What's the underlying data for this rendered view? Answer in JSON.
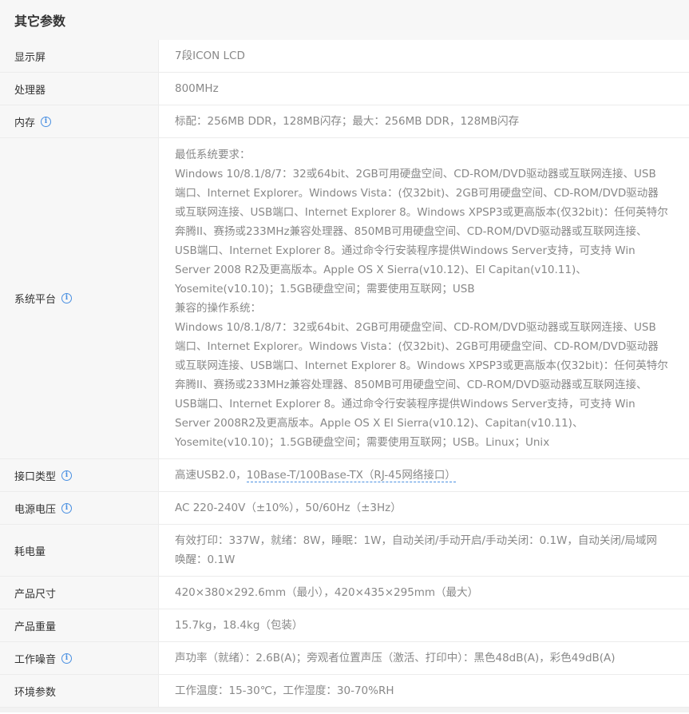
{
  "section": {
    "title": "其它参数"
  },
  "rows": {
    "display": {
      "label": "显示屏",
      "value": "7段ICON LCD"
    },
    "processor": {
      "label": "处理器",
      "value": "800MHz"
    },
    "memory": {
      "label": "内存",
      "value": "标配：256MB DDR，128MB闪存；最大：256MB DDR，128MB闪存"
    },
    "platform": {
      "label": "系统平台",
      "lines": [
        "最低系统要求：",
        "Windows 10/8.1/8/7：32或64bit、2GB可用硬盘空间、CD-ROM/DVD驱动器或互联网连接、USB",
        "端口、Internet Explorer。Windows Vista：(仅32bit)、2GB可用硬盘空间、CD-ROM/DVD驱动器",
        "或互联网连接、USB端口、Internet Explorer 8。Windows XPSP3或更高版本(仅32bit)：任何英特尔",
        "奔腾II、赛扬或233MHz兼容处理器、850MB可用硬盘空间、CD-ROM/DVD驱动器或互联网连接、",
        "USB端口、Internet Explorer 8。通过命令行安装程序提供Windows Server支持，可支持 Win",
        "Server 2008 R2及更高版本。Apple OS X Sierra(v10.12)、El Capitan(v10.11)、",
        "Yosemite(v10.10)；1.5GB硬盘空间；需要使用互联网；USB",
        "兼容的操作系统：",
        "Windows 10/8.1/8/7：32或64bit、2GB可用硬盘空间、CD-ROM/DVD驱动器或互联网连接、USB",
        "端口、Internet Explorer。Windows Vista：(仅32bit)、2GB可用硬盘空间、CD-ROM/DVD驱动器",
        "或互联网连接、USB端口、Internet Explorer 8。Windows XPSP3或更高版本(仅32bit)：任何英特尔",
        "奔腾II、赛扬或233MHz兼容处理器、850MB可用硬盘空间、CD-ROM/DVD驱动器或互联网连接、",
        "USB端口、Internet Explorer 8。通过命令行安装程序提供Windows Server支持，可支持 Win",
        "Server 2008R2及更高版本。Apple OS X El Sierra(v10.12)、Capitan(v10.11)、",
        "Yosemite(v10.10)；1.5GB硬盘空间；需要使用互联网；USB。Linux；Unix"
      ]
    },
    "interface": {
      "label": "接口类型",
      "value_prefix": "高速USB2.0，",
      "value_link": "10Base-T/100Base-TX（RJ-45网络接口）"
    },
    "voltage": {
      "label": "电源电压",
      "value": "AC 220-240V（±10%），50/60Hz（±3Hz）"
    },
    "power": {
      "label": "耗电量",
      "line1": "有效打印：337W，就绪：8W，睡眠：1W，自动关闭/手动开启/手动关闭：0.1W，自动关闭/局域网",
      "line2": "唤醒：0.1W"
    },
    "size": {
      "label": "产品尺寸",
      "value": "420×380×292.6mm（最小），420×435×295mm（最大）"
    },
    "weight": {
      "label": "产品重量",
      "value": "15.7kg，18.4kg（包装）"
    },
    "noise": {
      "label": "工作噪音",
      "value": "声功率（就绪）：2.6B(A)；旁观者位置声压（激活、打印中）：黑色48dB(A)，彩色49dB(A)"
    },
    "environment": {
      "label": "环境参数",
      "value": "工作温度：15-30℃，工作湿度：30-70%RH"
    }
  },
  "info_glyph": "i",
  "colors": {
    "icon_blue": "#4a90e2",
    "label_bg": "#f7f7f7",
    "value_text": "#888888"
  },
  "icons": {
    "info": "info-circle-icon"
  }
}
